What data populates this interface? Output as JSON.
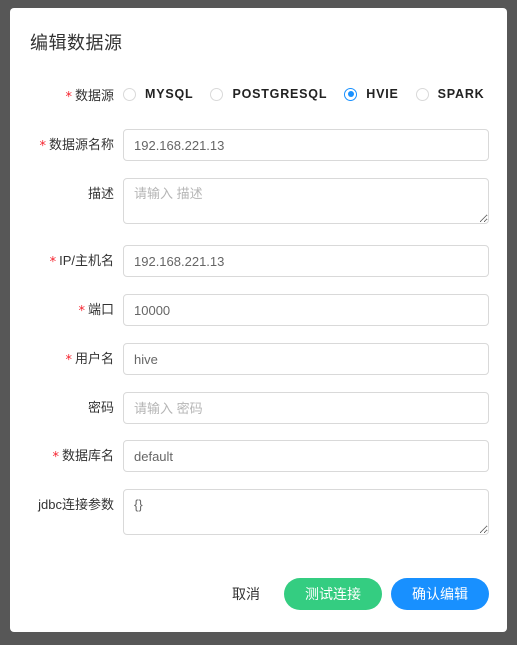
{
  "modal": {
    "title": "编辑数据源",
    "colors": {
      "accent_blue": "#1890ff",
      "accent_green": "#34cd81",
      "required_red": "#f5222d",
      "page_background": "#575757",
      "card_background": "#ffffff",
      "border": "#d9d9d9"
    }
  },
  "datasource_type": {
    "label": "数据源",
    "required": true,
    "selected": "HVIE",
    "options": [
      {
        "label": "MYSQL",
        "checked": false
      },
      {
        "label": "POSTGRESQL",
        "checked": false
      },
      {
        "label": "HVIE",
        "checked": true
      },
      {
        "label": "SPARK",
        "checked": false
      }
    ]
  },
  "fields": [
    {
      "name": "datasource-name",
      "label": "数据源名称",
      "required": true,
      "type": "input",
      "value": "192.168.221.13",
      "placeholder": ""
    },
    {
      "name": "description",
      "label": "描述",
      "required": false,
      "type": "textarea",
      "value": "",
      "placeholder": "请输入 描述"
    },
    {
      "name": "ip-host",
      "label": "IP/主机名",
      "required": true,
      "type": "input",
      "value": "192.168.221.13",
      "placeholder": ""
    },
    {
      "name": "port",
      "label": "端口",
      "required": true,
      "type": "input",
      "value": "10000",
      "placeholder": ""
    },
    {
      "name": "username",
      "label": "用户名",
      "required": true,
      "type": "input",
      "value": "hive",
      "placeholder": ""
    },
    {
      "name": "password",
      "label": "密码",
      "required": false,
      "type": "input",
      "value": "",
      "placeholder": "请输入 密码"
    },
    {
      "name": "database-name",
      "label": "数据库名",
      "required": true,
      "type": "input",
      "value": "default",
      "placeholder": ""
    },
    {
      "name": "jdbc-params",
      "label": "jdbc连接参数",
      "required": false,
      "type": "textarea",
      "value": "{}",
      "placeholder": ""
    }
  ],
  "footer": {
    "cancel_label": "取消",
    "test_label": "测试连接",
    "confirm_label": "确认编辑"
  }
}
